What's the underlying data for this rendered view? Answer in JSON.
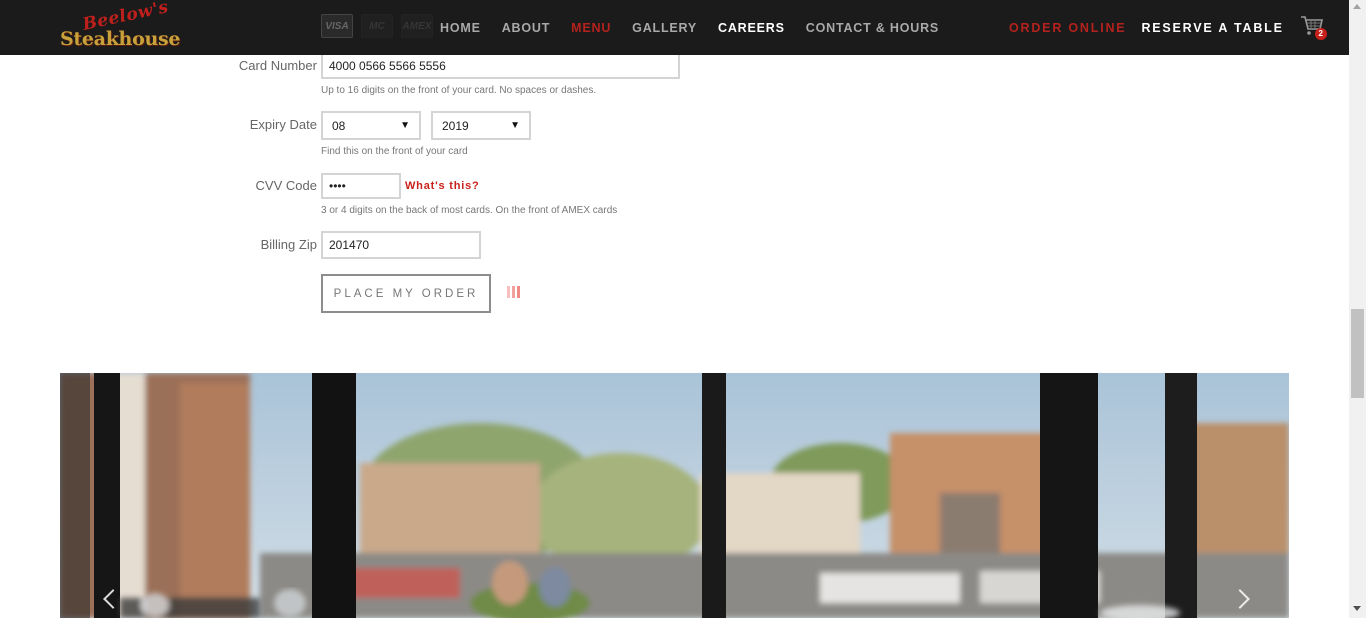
{
  "header": {
    "logo_script": "Beelow's",
    "logo_word": "Steakhouse",
    "card_brands": [
      "VISA",
      "MC",
      "AMEX"
    ],
    "nav": [
      {
        "label": "HOME",
        "state": "normal"
      },
      {
        "label": "ABOUT",
        "state": "normal"
      },
      {
        "label": "MENU",
        "state": "active"
      },
      {
        "label": "GALLERY",
        "state": "normal"
      },
      {
        "label": "CAREERS",
        "state": "bright"
      },
      {
        "label": "CONTACT & HOURS",
        "state": "normal"
      }
    ],
    "order_online": "ORDER ONLINE",
    "reserve": "RESERVE A TABLE",
    "cart_count": "2"
  },
  "form": {
    "card_number": {
      "label": "Card Number",
      "required": "*",
      "value": "4000 0566 5566 5556",
      "help": "Up to 16 digits on the front of your card. No spaces or dashes."
    },
    "expiry": {
      "label": "Expiry Date",
      "required": "*",
      "month": "08",
      "year": "2019",
      "help": "Find this on the front of your card"
    },
    "cvv": {
      "label": "CVV Code",
      "required": "*",
      "value": "••••",
      "whats_this": "What's this?",
      "help": "3 or 4 digits on the back of most cards. On the front of AMEX cards"
    },
    "zip": {
      "label": "Billing Zip",
      "required": "*",
      "value": "201470"
    },
    "submit_label": "PLACE MY ORDER"
  },
  "colors": {
    "nav_bg": "#1b1b1b",
    "accent_red": "#b5221d",
    "logo_gold": "#c7a13a"
  },
  "icons": [
    "cart-icon",
    "spinner-icon",
    "chevron-left-icon",
    "chevron-right-icon"
  ]
}
